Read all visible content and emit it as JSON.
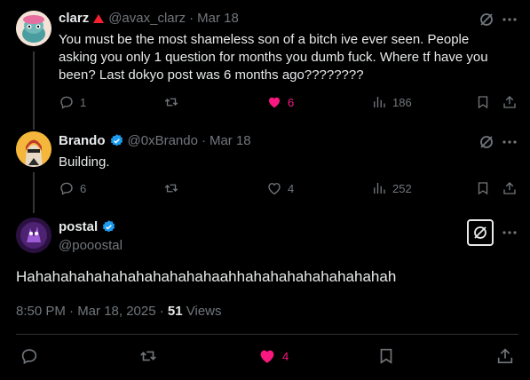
{
  "tweets": [
    {
      "name": "clarz",
      "handle": "@avax_clarz",
      "date": "Mar 18",
      "text": "You must be the most shameless son of a bitch ive ever seen. People asking you only 1 question for months you dumb fuck. Where tf have you been? Last dokyo post was 6 months ago????????",
      "replies": "1",
      "retweets": "",
      "likes": "6",
      "views": "186"
    },
    {
      "name": "Brando",
      "handle": "@0xBrando",
      "date": "Mar 18",
      "text": "Building.",
      "replies": "6",
      "retweets": "",
      "likes": "4",
      "views": "252"
    }
  ],
  "main": {
    "name": "postal",
    "handle": "@pooostal",
    "text": "Hahahahahahahahahahahahaahhahahahahahahahahah",
    "meta_time": "8:50 PM · Mar 18, 2025 · ",
    "views_count": "51",
    "views_label": " Views",
    "likes": "4"
  },
  "colors": {
    "like": "#f91880",
    "verified": "#1d9bf0",
    "muted": "#71767b"
  }
}
